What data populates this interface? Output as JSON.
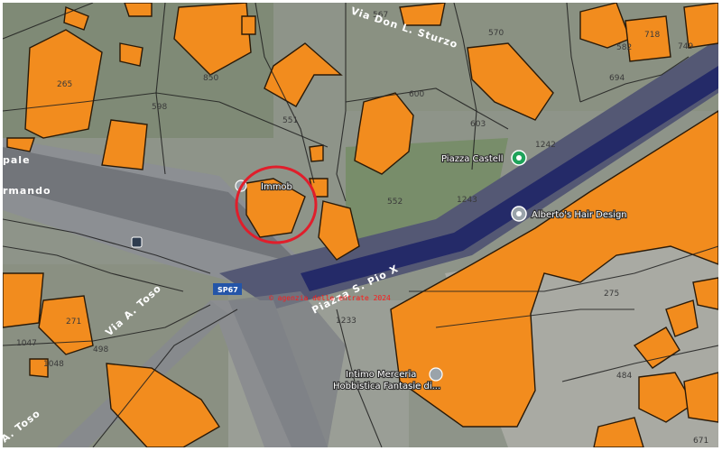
{
  "map": {
    "streets": {
      "via_don_sturzo": "Via Don L. Sturzo",
      "piazza_pio_x": "Piazza S. Pio X",
      "via_toso": "Via A. Toso",
      "via_toso_lower": "A. Toso",
      "pale": "pale",
      "mando": "rmando"
    },
    "road_badge": "SP67",
    "poi": {
      "piazza": "Piazza Castell",
      "hair": "Alberto's Hair Design",
      "immob": "Immob",
      "intimo": "Intimo Merceria",
      "hobbistica": "Hobbistica Fantasie di..."
    },
    "credit": "© agenzia delle entrate 2024",
    "parcel_numbers": [
      "567",
      "570",
      "582",
      "718",
      "749",
      "265",
      "850",
      "598",
      "551",
      "600",
      "603",
      "694",
      "1242",
      "552",
      "1243",
      "271",
      "1047",
      "498",
      "1048",
      "1233",
      "275",
      "484",
      "671"
    ],
    "highlight_color": "#e01e2b",
    "parcel_color": "#f28c1e"
  }
}
